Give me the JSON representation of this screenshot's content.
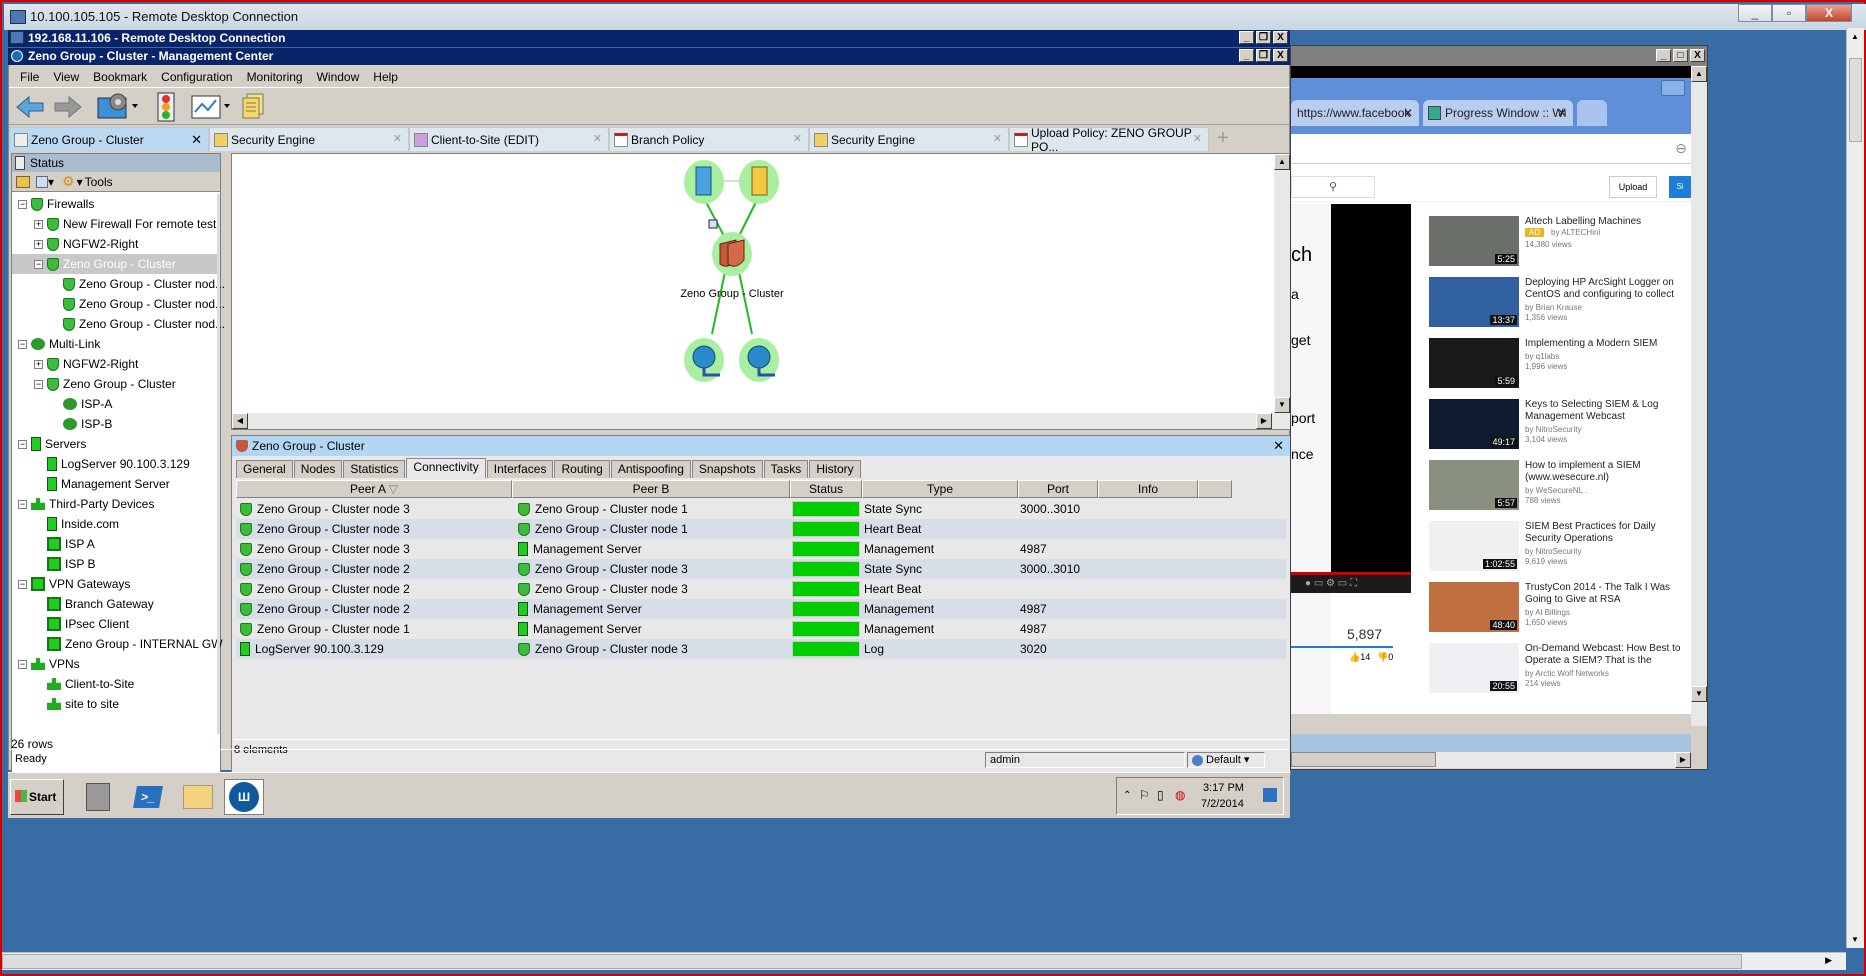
{
  "outer_window": {
    "title": "10.100.105.105 - Remote Desktop Connection",
    "controls": [
      "minimize",
      "restore",
      "close"
    ]
  },
  "inner_window": {
    "title": "192.168.11.106 - Remote Desktop Connection"
  },
  "app": {
    "title": "Zeno Group - Cluster - Management Center",
    "menu": [
      "File",
      "View",
      "Bookmark",
      "Configuration",
      "Monitoring",
      "Window",
      "Help"
    ],
    "toolbar": [
      {
        "icon": "back-arrow-icon",
        "label": "Back"
      },
      {
        "icon": "forward-arrow-icon",
        "label": "Forward"
      },
      {
        "icon": "configuration-icon",
        "label": "Configuration"
      },
      {
        "icon": "traffic-light-icon",
        "label": "Status"
      },
      {
        "icon": "monitoring-chart-icon",
        "label": "Monitoring"
      },
      {
        "icon": "documents-icon",
        "label": "Documents"
      }
    ],
    "tabs": [
      {
        "label": "Zeno Group - Cluster",
        "icon": "traffic-light-icon",
        "active": true
      },
      {
        "label": "Security Engine",
        "icon": "documents-icon"
      },
      {
        "label": "Client-to-Site (EDIT)",
        "icon": "edit-pencil-icon"
      },
      {
        "label": "Branch Policy",
        "icon": "policy-icon"
      },
      {
        "label": "Security Engine",
        "icon": "documents-icon"
      },
      {
        "label": "Upload Policy: ZENO GROUP PO...",
        "icon": "upload-policy-icon"
      }
    ],
    "add_tab": "+"
  },
  "sidebar": {
    "header": "Status",
    "tools_label": "Tools",
    "rows_count": "26 rows",
    "tree": [
      {
        "label": "Firewalls",
        "level": 0,
        "icon": "firewall",
        "expander": "-"
      },
      {
        "label": "New Firewall For remote test",
        "level": 1,
        "icon": "firewall",
        "expander": "+"
      },
      {
        "label": "NGFW2-Right",
        "level": 1,
        "icon": "firewall",
        "expander": "+"
      },
      {
        "label": "Zeno Group - Cluster",
        "level": 1,
        "icon": "firewall",
        "expander": "-",
        "selected": true
      },
      {
        "label": "Zeno Group - Cluster nod...",
        "level": 2,
        "icon": "firewall"
      },
      {
        "label": "Zeno Group - Cluster nod...",
        "level": 2,
        "icon": "firewall"
      },
      {
        "label": "Zeno Group - Cluster nod...",
        "level": 2,
        "icon": "firewall"
      },
      {
        "label": "Multi-Link",
        "level": 0,
        "icon": "multilink",
        "expander": "-"
      },
      {
        "label": "NGFW2-Right",
        "level": 1,
        "icon": "firewall",
        "expander": "+"
      },
      {
        "label": "Zeno Group - Cluster",
        "level": 1,
        "icon": "firewall",
        "expander": "-"
      },
      {
        "label": "ISP-A",
        "level": 2,
        "icon": "multilink"
      },
      {
        "label": "ISP-B",
        "level": 2,
        "icon": "multilink"
      },
      {
        "label": "Servers",
        "level": 0,
        "icon": "server",
        "expander": "-"
      },
      {
        "label": "LogServer 90.100.3.129",
        "level": 1,
        "icon": "server"
      },
      {
        "label": "Management Server",
        "level": 1,
        "icon": "server"
      },
      {
        "label": "Third-Party Devices",
        "level": 0,
        "icon": "vpn",
        "expander": "-"
      },
      {
        "label": "Inside.com",
        "level": 1,
        "icon": "server"
      },
      {
        "label": "ISP A",
        "level": 1,
        "icon": "gateway"
      },
      {
        "label": "ISP B",
        "level": 1,
        "icon": "gateway"
      },
      {
        "label": "VPN Gateways",
        "level": 0,
        "icon": "gateway",
        "expander": "-"
      },
      {
        "label": "Branch Gateway",
        "level": 1,
        "icon": "gateway"
      },
      {
        "label": "IPsec Client",
        "level": 1,
        "icon": "gateway"
      },
      {
        "label": "Zeno Group -  INTERNAL GW",
        "level": 1,
        "icon": "gateway"
      },
      {
        "label": "VPNs",
        "level": 0,
        "icon": "vpn",
        "expander": "-"
      },
      {
        "label": "Client-to-Site",
        "level": 1,
        "icon": "vpn"
      },
      {
        "label": "site to site",
        "level": 1,
        "icon": "vpn"
      }
    ]
  },
  "diagram": {
    "cluster_label": "Zeno Group - Cluster",
    "nodes": [
      "log-server",
      "management-server",
      "cluster",
      "internet-isp-a",
      "internet-isp-b"
    ]
  },
  "detail": {
    "title": "Zeno Group - Cluster",
    "tabs": [
      "General",
      "Nodes",
      "Statistics",
      "Connectivity",
      "Interfaces",
      "Routing",
      "Antispoofing",
      "Snapshots",
      "Tasks",
      "History"
    ],
    "active_tab": "Connectivity",
    "columns": [
      "Peer A",
      "Peer B",
      "Status",
      "Type",
      "Port",
      "Info"
    ],
    "sort_indicator": "▽",
    "rows": [
      {
        "peer_a": "Zeno Group - Cluster node 3",
        "a_icon": "firewall",
        "peer_b": "Zeno Group - Cluster node 1",
        "b_icon": "firewall",
        "status": "ok",
        "type": "State Sync",
        "port": "3000..3010",
        "info": ""
      },
      {
        "peer_a": "Zeno Group - Cluster node 3",
        "a_icon": "firewall",
        "peer_b": "Zeno Group - Cluster node 1",
        "b_icon": "firewall",
        "status": "ok",
        "type": "Heart Beat",
        "port": "",
        "info": ""
      },
      {
        "peer_a": "Zeno Group - Cluster node 3",
        "a_icon": "firewall",
        "peer_b": "Management Server",
        "b_icon": "server",
        "status": "ok",
        "type": "Management",
        "port": "4987",
        "info": ""
      },
      {
        "peer_a": "Zeno Group - Cluster node 2",
        "a_icon": "firewall",
        "peer_b": "Zeno Group - Cluster node 3",
        "b_icon": "firewall",
        "status": "ok",
        "type": "State Sync",
        "port": "3000..3010",
        "info": ""
      },
      {
        "peer_a": "Zeno Group - Cluster node 2",
        "a_icon": "firewall",
        "peer_b": "Zeno Group - Cluster node 3",
        "b_icon": "firewall",
        "status": "ok",
        "type": "Heart Beat",
        "port": "",
        "info": ""
      },
      {
        "peer_a": "Zeno Group - Cluster node 2",
        "a_icon": "firewall",
        "peer_b": "Management Server",
        "b_icon": "server",
        "status": "ok",
        "type": "Management",
        "port": "4987",
        "info": ""
      },
      {
        "peer_a": "Zeno Group - Cluster node 1",
        "a_icon": "firewall",
        "peer_b": "Management Server",
        "b_icon": "server",
        "status": "ok",
        "type": "Management",
        "port": "4987",
        "info": ""
      },
      {
        "peer_a": "LogServer 90.100.3.129",
        "a_icon": "server",
        "peer_b": "Zeno Group - Cluster node 3",
        "b_icon": "firewall",
        "status": "ok",
        "type": "Log",
        "port": "3020",
        "info": ""
      }
    ],
    "element_count": "8 elements",
    "status_color": "#00cc00"
  },
  "statusbar": {
    "left": "Ready",
    "user": "admin",
    "profile": "Default"
  },
  "taskbar": {
    "start": "Start",
    "apps": [
      "server-manager-icon",
      "powershell-icon",
      "explorer-folder-icon",
      "management-center-icon"
    ],
    "time": "3:17 PM",
    "date": "7/2/2014"
  },
  "browser": {
    "tabs": [
      "https://www.facebook",
      "Progress Window :: Wi"
    ],
    "upload_label": "Upload",
    "signin_label": "Si",
    "side_text": [
      "ch",
      "a",
      "get",
      "port",
      "nce"
    ],
    "view_count": "5,897",
    "likes": "14",
    "dislikes": "0",
    "related": [
      {
        "title": "Altech Labelling Machines",
        "by": "by ALTECHinl",
        "views": "14,380 views",
        "duration": "5:25",
        "ad": "AD"
      },
      {
        "title": "Deploying HP ArcSight Logger on CentOS and configuring to collect",
        "by": "by Brian Krause",
        "views": "1,356 views",
        "duration": "13:37"
      },
      {
        "title": "Implementing a Modern SIEM",
        "by": "by q1labs",
        "views": "1,996 views",
        "duration": "5:59"
      },
      {
        "title": "Keys to Selecting SIEM & Log Management Webcast",
        "by": "by NitroSecurity",
        "views": "3,104 views",
        "duration": "49:17"
      },
      {
        "title": "How to implement a SIEM (www.wesecure.nl)",
        "by": "by WeSecureNL .",
        "views": "788 views",
        "duration": "5:57"
      },
      {
        "title": "SIEM Best Practices for Daily Security Operations",
        "by": "by NitroSecurity",
        "views": "9,619 views",
        "duration": "1:02:55"
      },
      {
        "title": "TrustyCon 2014 - The Talk I Was Going to Give at RSA",
        "by": "by Al Billings",
        "views": "1,650 views",
        "duration": "48:40"
      },
      {
        "title": "On-Demand Webcast: How Best to Operate a SIEM? That is the",
        "by": "by Arctic Wolf Networks",
        "views": "214 views",
        "duration": "20:55"
      }
    ]
  }
}
